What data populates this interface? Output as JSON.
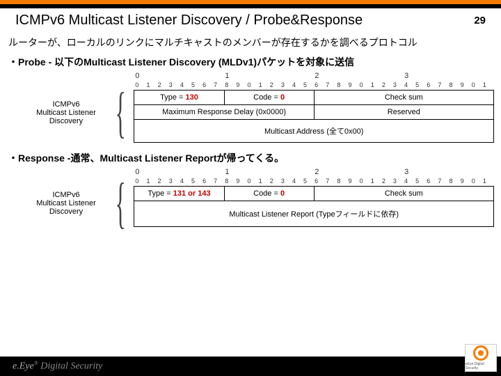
{
  "page_number": "29",
  "title": "ICMPv6 Multicast Listener Discovery / Probe&Response",
  "description": "ルーターが、ローカルのリンクにマルチキャストのメンバーが存在するかを調べるプロトコル",
  "probe_heading": "・Probe - 以下のMulticast Listener Discovery (MLDv1)パケットを対象に送信",
  "response_heading": "・Response -通常、Multicast Listener Reportが帰ってくる。",
  "ruler_tens": [
    "0",
    "1",
    "2",
    "3"
  ],
  "ruler_ones": [
    "0",
    "1",
    "2",
    "3",
    "4",
    "5",
    "6",
    "7",
    "8",
    "9",
    "0",
    "1",
    "2",
    "3",
    "4",
    "5",
    "6",
    "7",
    "8",
    "9",
    "0",
    "1",
    "2",
    "3",
    "4",
    "5",
    "6",
    "7",
    "8",
    "9",
    "0",
    "1"
  ],
  "side_label": "ICMPv6\nMulticast Listener\nDiscovery",
  "probe": {
    "type_label": "Type = ",
    "type_value": "130",
    "code_label": "Code = ",
    "code_value": "0",
    "checksum": "Check sum",
    "max_delay": "Maximum Response Delay (0x0000)",
    "reserved": "Reserved",
    "multicast_addr": "Multicast Address (全て0x00)"
  },
  "response": {
    "type_label": "Type = ",
    "type_value": "131 or 143",
    "code_label": "Code = ",
    "code_value": "0",
    "checksum": "Check sum",
    "report": "Multicast Listener Report (Typeフィールドに依存)"
  },
  "footer_brand": "e.Eye® Digital Security",
  "footer_logo_caption": "eEye Digital Security"
}
